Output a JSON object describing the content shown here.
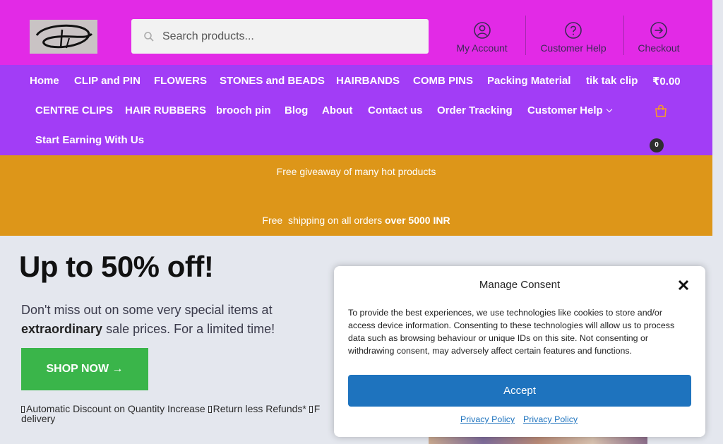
{
  "header": {
    "search_placeholder": "Search products...",
    "links": [
      {
        "label": "My Account",
        "icon": "account-circle-icon"
      },
      {
        "label": "Customer Help",
        "icon": "help-circle-icon"
      },
      {
        "label": "Checkout",
        "icon": "arrow-circle-icon"
      }
    ]
  },
  "nav": {
    "items": [
      "Home",
      "CLIP and PIN",
      "FLOWERS",
      "STONES and BEADS",
      "HAIRBANDS",
      "COMB PINS",
      "Packing Material",
      "tik tak clip",
      "₹0.00",
      "CENTRE CLIPS",
      "HAIR RUBBERS",
      "brooch pin",
      "Blog",
      "About",
      "Contact us",
      "Order Tracking",
      "Customer Help",
      "Start Earning With Us"
    ],
    "cart_count": "0"
  },
  "banner": {
    "line1": "Free giveaway of many hot products",
    "line2_prefix": "Free  shipping on all orders ",
    "line2_bold": "over 5000 INR"
  },
  "hero": {
    "title": "Up to 50% off!",
    "text_prefix": "Don't miss out on some very special items at ",
    "text_bold": "extraordinary",
    "text_suffix": " sale prices. For a limited time!",
    "button": "SHOP NOW →",
    "features": [
      "Automatic Discount on Quantity Increase ",
      "Return less Refunds* ",
      "F",
      "delivery"
    ]
  },
  "consent": {
    "title": "Manage Consent",
    "body": "To provide the best experiences, we use technologies like cookies to store and/or access device information. Consenting to these technologies will allow us to process data such as browsing behaviour or unique IDs on this site. Not consenting or withdrawing consent, may adversely affect certain features and functions.",
    "accept": "Accept",
    "links": [
      "Privacy Policy",
      "Privacy Policy"
    ]
  },
  "colors": {
    "header_bg": "#e22ae6",
    "nav_bg": "#a23df6",
    "banner_bg": "#dd9619",
    "shop_button": "#3ab54a",
    "accept_button": "#1e73be"
  }
}
